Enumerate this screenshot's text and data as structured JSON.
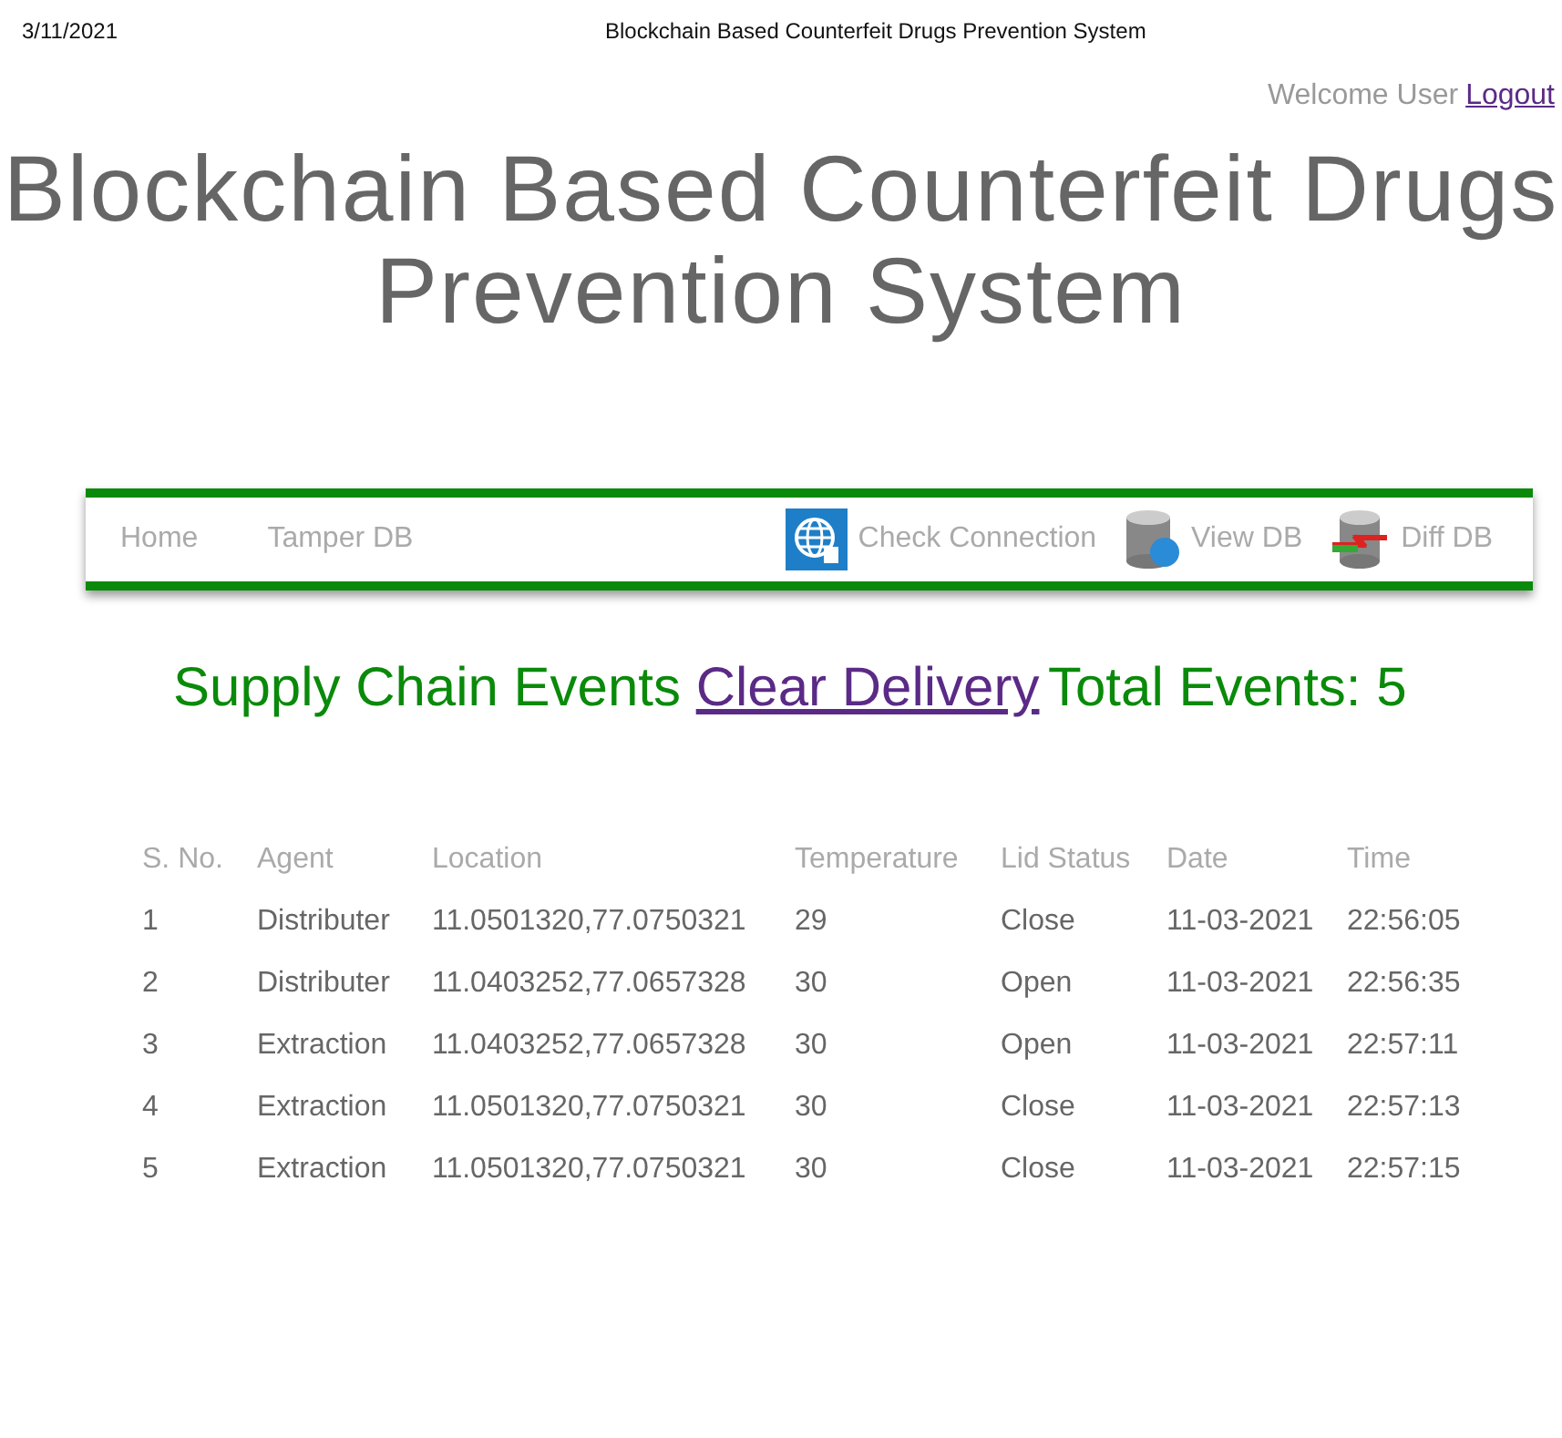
{
  "print_header": {
    "date": "3/11/2021",
    "title": "Blockchain Based Counterfeit Drugs Prevention System"
  },
  "user_bar": {
    "welcome": "Welcome User",
    "logout": "Logout"
  },
  "title": "Blockchain Based Counterfeit Drugs Prevention System",
  "nav": [
    {
      "label": "Home",
      "kind": "plain"
    },
    {
      "label": "Tamper DB",
      "kind": "plain"
    },
    {
      "label": "Check Connection",
      "kind": "web"
    },
    {
      "label": "View DB",
      "kind": "database"
    },
    {
      "label": "Diff DB",
      "kind": "sync"
    }
  ],
  "events_heading": {
    "text": "Supply Chain Events",
    "link": "Clear Delivery",
    "total": "Total Events: 5"
  },
  "table": {
    "columns": [
      "S. No.",
      "Agent",
      "Location",
      "Temperature",
      "Lid Status",
      "Date",
      "Time"
    ],
    "rows": [
      [
        "1",
        "Distributer",
        "11.0501320,77.0750321",
        "29",
        "Close",
        "11-03-2021",
        "22:56:05"
      ],
      [
        "2",
        "Distributer",
        "11.0403252,77.0657328",
        "30",
        "Open",
        "11-03-2021",
        "22:56:35"
      ],
      [
        "3",
        "Extraction",
        "11.0403252,77.0657328",
        "30",
        "Open",
        "11-03-2021",
        "22:57:11"
      ],
      [
        "4",
        "Extraction",
        "11.0501320,77.0750321",
        "30",
        "Close",
        "11-03-2021",
        "22:57:13"
      ],
      [
        "5",
        "Extraction",
        "11.0501320,77.0750321",
        "30",
        "Close",
        "11-03-2021",
        "22:57:15"
      ]
    ]
  }
}
